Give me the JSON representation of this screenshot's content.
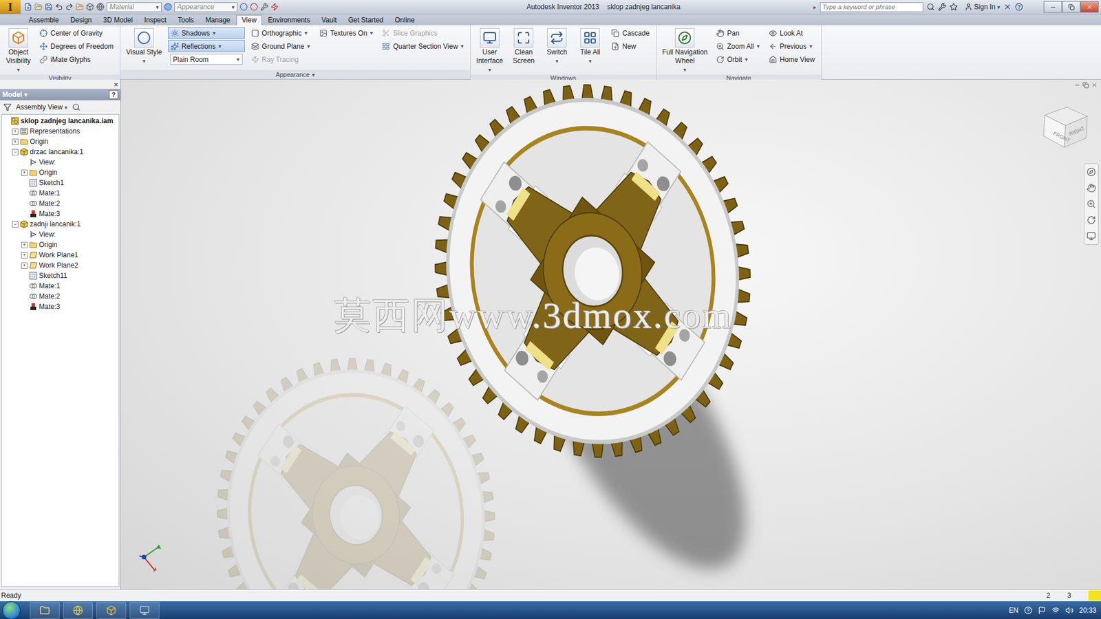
{
  "app_logo": "I",
  "dropdown_glyph": "▾",
  "window": {
    "app": "Autodesk Inventor 2013",
    "document": "sklop zadnjeg lancanika"
  },
  "quick_access": {
    "material": "Material",
    "appearance": "Appearance"
  },
  "search": {
    "placeholder": "Type a keyword or phrase",
    "arrow": "▸"
  },
  "sign_in": "Sign In",
  "tabs": [
    {
      "label": "Assemble",
      "selected": false
    },
    {
      "label": "Design",
      "selected": false
    },
    {
      "label": "3D Model",
      "selected": false
    },
    {
      "label": "Inspect",
      "selected": false
    },
    {
      "label": "Tools",
      "selected": false
    },
    {
      "label": "Manage",
      "selected": false
    },
    {
      "label": "View",
      "selected": true
    },
    {
      "label": "Environments",
      "selected": false
    },
    {
      "label": "Vault",
      "selected": false
    },
    {
      "label": "Get Started",
      "selected": false
    },
    {
      "label": "Online",
      "selected": false
    }
  ],
  "ribbon": {
    "panels": [
      {
        "title": "Visibility",
        "menu": false,
        "columns": [
          [
            {
              "kind": "large",
              "lines": [
                "Object",
                "Visibility"
              ],
              "dropdown": true,
              "disabled": false,
              "active": false
            }
          ],
          [
            {
              "kind": "small",
              "lines": [
                "Center of Gravity"
              ],
              "dropdown": false,
              "disabled": false,
              "active": false
            },
            {
              "kind": "small",
              "lines": [
                "Degrees of Freedom"
              ],
              "dropdown": false,
              "disabled": false,
              "active": false
            },
            {
              "kind": "small",
              "lines": [
                "iMate Glyphs"
              ],
              "dropdown": false,
              "disabled": false,
              "active": false
            }
          ]
        ]
      },
      {
        "title": "Appearance",
        "menu": true,
        "columns": [
          [
            {
              "kind": "large",
              "lines": [
                "Visual Style"
              ],
              "dropdown": true,
              "disabled": false,
              "active": false
            }
          ],
          [
            {
              "kind": "small",
              "lines": [
                "Shadows"
              ],
              "dropdown": true,
              "disabled": false,
              "active": true
            },
            {
              "kind": "small",
              "lines": [
                "Reflections"
              ],
              "dropdown": true,
              "disabled": false,
              "active": true
            },
            {
              "kind": "select",
              "lines": [
                "Plain Room"
              ],
              "dropdown": true,
              "disabled": false,
              "active": false
            }
          ],
          [
            {
              "kind": "small",
              "lines": [
                "Orthographic"
              ],
              "dropdown": true,
              "disabled": false,
              "active": false
            },
            {
              "kind": "small",
              "lines": [
                "Ground Plane"
              ],
              "dropdown": true,
              "disabled": false,
              "active": false
            },
            {
              "kind": "small",
              "lines": [
                "Ray Tracing"
              ],
              "dropdown": false,
              "disabled": true,
              "active": false
            }
          ],
          [
            {
              "kind": "small",
              "lines": [
                "Textures On"
              ],
              "dropdown": true,
              "disabled": false,
              "active": false
            }
          ],
          [
            {
              "kind": "small",
              "lines": [
                "Slice Graphics"
              ],
              "dropdown": false,
              "disabled": true,
              "active": false
            },
            {
              "kind": "small",
              "lines": [
                "Quarter Section View"
              ],
              "dropdown": true,
              "disabled": false,
              "active": false
            }
          ]
        ]
      },
      {
        "title": "Windows",
        "menu": false,
        "columns": [
          [
            {
              "kind": "large",
              "lines": [
                "User",
                "Interface"
              ],
              "dropdown": true,
              "disabled": false,
              "active": false
            }
          ],
          [
            {
              "kind": "large",
              "lines": [
                "Clean",
                "Screen"
              ],
              "dropdown": false,
              "disabled": false,
              "active": false
            }
          ],
          [
            {
              "kind": "large",
              "lines": [
                "Switch"
              ],
              "dropdown": true,
              "disabled": false,
              "active": false
            }
          ],
          [
            {
              "kind": "large",
              "lines": [
                "Tile All"
              ],
              "dropdown": true,
              "disabled": false,
              "active": false
            }
          ],
          [
            {
              "kind": "small",
              "lines": [
                "Cascade"
              ],
              "dropdown": false,
              "disabled": false,
              "active": false
            },
            {
              "kind": "small",
              "lines": [
                "New"
              ],
              "dropdown": false,
              "disabled": false,
              "active": false
            }
          ]
        ]
      },
      {
        "title": "Navigate",
        "menu": false,
        "columns": [
          [
            {
              "kind": "large",
              "lines": [
                "Full Navigation",
                "Wheel"
              ],
              "dropdown": true,
              "disabled": false,
              "active": false
            }
          ],
          [
            {
              "kind": "small",
              "lines": [
                "Pan"
              ],
              "dropdown": false,
              "disabled": false,
              "active": false
            },
            {
              "kind": "small",
              "lines": [
                "Zoom All"
              ],
              "dropdown": true,
              "disabled": false,
              "active": false
            },
            {
              "kind": "small",
              "lines": [
                "Orbit"
              ],
              "dropdown": true,
              "disabled": false,
              "active": false
            }
          ],
          [
            {
              "kind": "small",
              "lines": [
                "Look At"
              ],
              "dropdown": false,
              "disabled": false,
              "active": false
            },
            {
              "kind": "small",
              "lines": [
                "Previous"
              ],
              "dropdown": true,
              "disabled": false,
              "active": false
            },
            {
              "kind": "small",
              "lines": [
                "Home View"
              ],
              "dropdown": false,
              "disabled": false,
              "active": false
            }
          ]
        ]
      }
    ]
  },
  "browser": {
    "title": "Model",
    "view": "Assembly View",
    "help": "?",
    "close": "×",
    "items": [
      {
        "label": "sklop zadnjeg lancanika.iam",
        "level": 0,
        "kind": "assembly",
        "expandable": false,
        "expanded": false,
        "bold": true
      },
      {
        "label": "Representations",
        "level": 1,
        "kind": "representations",
        "expandable": true,
        "expanded": false,
        "bold": false
      },
      {
        "label": "Origin",
        "level": 1,
        "kind": "folder",
        "expandable": true,
        "expanded": false,
        "bold": false
      },
      {
        "label": "drzac lancanika:1",
        "level": 1,
        "kind": "part",
        "expandable": true,
        "expanded": true,
        "bold": false
      },
      {
        "label": "View:",
        "level": 2,
        "kind": "view",
        "expandable": false,
        "expanded": false,
        "bold": false
      },
      {
        "label": "Origin",
        "level": 2,
        "kind": "folder",
        "expandable": true,
        "expanded": false,
        "bold": false
      },
      {
        "label": "Sketch1",
        "level": 2,
        "kind": "sketch",
        "expandable": false,
        "expanded": false,
        "bold": false
      },
      {
        "label": "Mate:1",
        "level": 2,
        "kind": "mate",
        "expandable": false,
        "expanded": false,
        "bold": false
      },
      {
        "label": "Mate:2",
        "level": 2,
        "kind": "mate",
        "expandable": false,
        "expanded": false,
        "bold": false
      },
      {
        "label": "Mate:3",
        "level": 2,
        "kind": "mate-alt",
        "expandable": false,
        "expanded": false,
        "bold": false
      },
      {
        "label": "zadnji lancanik:1",
        "level": 1,
        "kind": "part",
        "expandable": true,
        "expanded": true,
        "bold": false
      },
      {
        "label": "View:",
        "level": 2,
        "kind": "view",
        "expandable": false,
        "expanded": false,
        "bold": false
      },
      {
        "label": "Origin",
        "level": 2,
        "kind": "folder",
        "expandable": true,
        "expanded": false,
        "bold": false
      },
      {
        "label": "Work Plane1",
        "level": 2,
        "kind": "plane",
        "expandable": true,
        "expanded": false,
        "bold": false
      },
      {
        "label": "Work Plane2",
        "level": 2,
        "kind": "plane",
        "expandable": true,
        "expanded": false,
        "bold": false
      },
      {
        "label": "Sketch11",
        "level": 2,
        "kind": "sketch",
        "expandable": false,
        "expanded": false,
        "bold": false
      },
      {
        "label": "Mate:1",
        "level": 2,
        "kind": "mate",
        "expandable": false,
        "expanded": false,
        "bold": false
      },
      {
        "label": "Mate:2",
        "level": 2,
        "kind": "mate",
        "expandable": false,
        "expanded": false,
        "bold": false
      },
      {
        "label": "Mate:3",
        "level": 2,
        "kind": "mate-alt",
        "expandable": false,
        "expanded": false,
        "bold": false
      }
    ]
  },
  "viewport": {
    "watermark": "莫西网www.3dmox.com",
    "viewcube": {
      "front": "FRONT",
      "right": "RIGHT"
    }
  },
  "status_bar": {
    "text": "Ready",
    "counts": [
      "2",
      "3"
    ]
  },
  "taskbar": {
    "language": "EN",
    "time": "20:33"
  }
}
